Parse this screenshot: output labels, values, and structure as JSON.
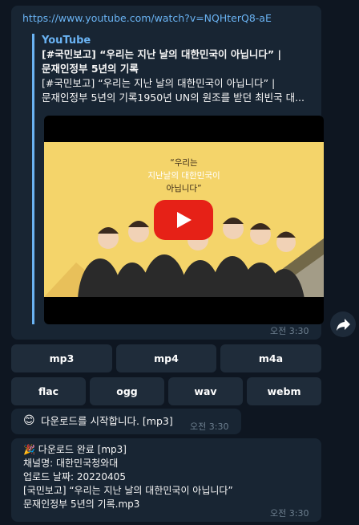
{
  "message1": {
    "url": "https://www.youtube.com/watch?v=NQHterQ8-aE",
    "preview": {
      "site_name": "YouTube",
      "title_line1": "[#국민보고] “우리는 지난 날의 대한민국이 아닙니다” |",
      "title_line2": "문재인정부 5년의 기록",
      "desc_line1": "[#국민보고] “우리는 지난 날의 대한민국이 아닙니다” |",
      "desc_line2": "문재인정부 5년의 기록1950년 UN의 원조를 받던 최빈국 대...",
      "thumbnail": {
        "line1": "“우리는",
        "line2": "지난날의 대한민국이",
        "line3": "아닙니다”"
      }
    },
    "time": "오전 3:30"
  },
  "keyboard": {
    "row1": [
      "mp3",
      "mp4",
      "m4a"
    ],
    "row2": [
      "flac",
      "ogg",
      "wav",
      "webm"
    ]
  },
  "message2": {
    "emoji": "😊",
    "text": "다운로드를 시작합니다. [mp3]",
    "time": "오전 3:30"
  },
  "message3": {
    "emoji": "🎉",
    "line1": "다운로드 완료 [mp3]",
    "line2": "채널명: 대한민국청와대",
    "line3": "업로드 날짜: 20220405",
    "line4": "[국민보고] “우리는 지난 날의 대한민국이 아닙니다”",
    "line5": "문재인정부 5년의 기록.mp3",
    "time": "오전 3:30"
  },
  "icons": {
    "play": "youtube-play-icon",
    "share": "share-arrow-icon"
  },
  "colors": {
    "background": "#0e1621",
    "bubble": "#182533",
    "link": "#6ab3f3",
    "button": "#1f2c3a",
    "youtube_red": "#e62117",
    "thumbnail_bg": "#f4d46a"
  }
}
